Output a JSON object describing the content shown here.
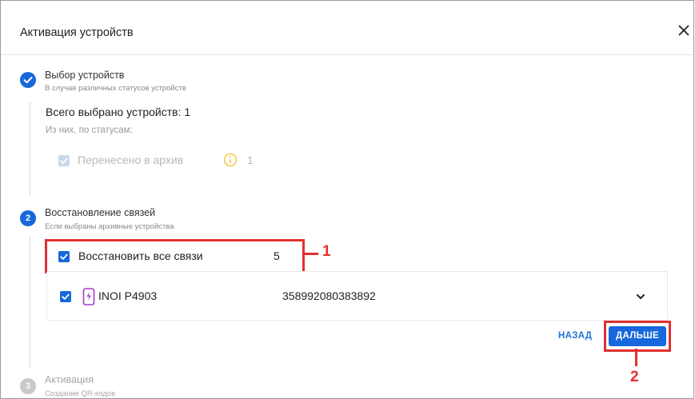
{
  "dialog": {
    "title": "Активация устройств",
    "close_icon": "close-icon"
  },
  "step1": {
    "title": "Выбор устройств",
    "subtitle": "В случае различных статусов устройств",
    "icon": "check-icon",
    "total_label": "Всего выбрано устройств: 1",
    "by_status_label": "Из них, по статусам:",
    "archived_label": "Перенесено в архив",
    "archived_count": "1",
    "info_icon": "info-icon"
  },
  "step2": {
    "number": "2",
    "title": "Восстановление связей",
    "subtitle": "Если выбраны архивные устройства",
    "restore_all_label": "Восстановить все связи",
    "restore_all_count": "5",
    "device": {
      "name": "INOI P4903",
      "id": "358992080383892",
      "icon": "phone-icon"
    }
  },
  "step3": {
    "number": "3",
    "title": "Активация",
    "subtitle": "Создание QR-кодов"
  },
  "buttons": {
    "back": "НАЗАД",
    "next": "ДАЛЬШЕ"
  },
  "annotations": {
    "label1": "1",
    "label2": "2"
  },
  "colors": {
    "accent": "#1668dc",
    "annotation": "#e03030",
    "info": "#f5b800"
  }
}
